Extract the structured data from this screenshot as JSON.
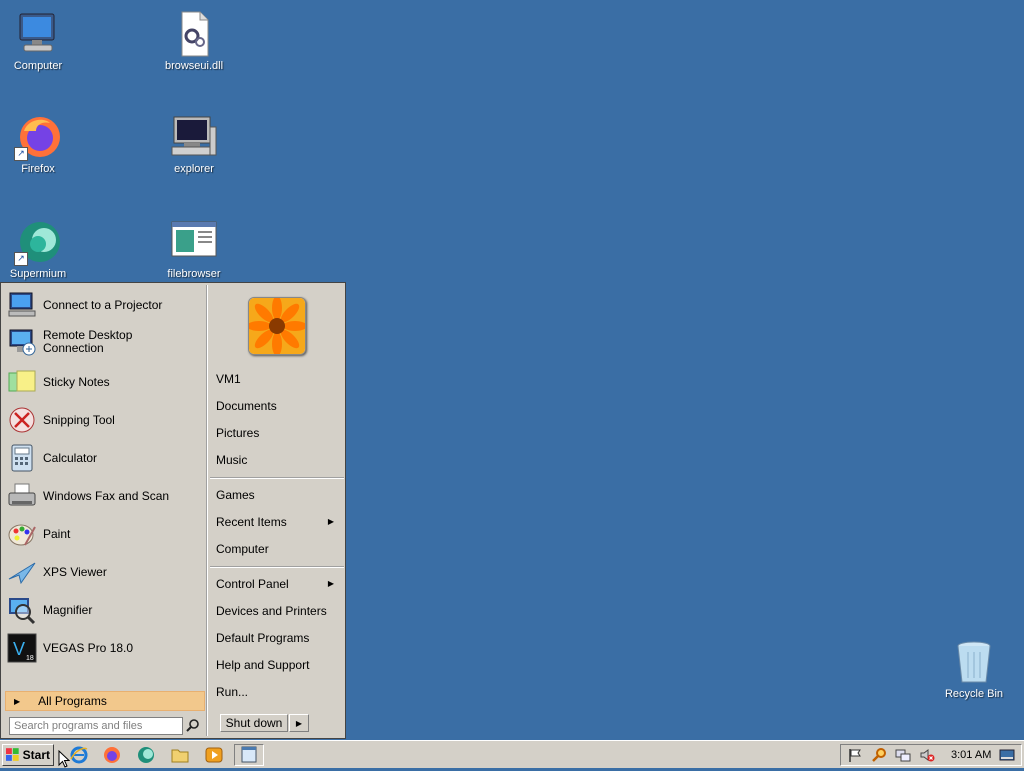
{
  "desktop": {
    "icons": [
      {
        "label": "Computer",
        "icon": "computer-icon"
      },
      {
        "label": "browseui.dll",
        "icon": "dll-file-icon"
      },
      {
        "label": "Firefox",
        "icon": "firefox-icon"
      },
      {
        "label": "explorer",
        "icon": "explorer-icon"
      },
      {
        "label": "Supermium",
        "icon": "supermium-icon"
      },
      {
        "label": "filebrowser",
        "icon": "filebrowser-icon"
      },
      {
        "label": "Recycle Bin",
        "icon": "recycle-bin-icon"
      }
    ]
  },
  "start_menu": {
    "programs": [
      {
        "label": "Connect to a Projector",
        "icon": "projector-icon"
      },
      {
        "label": "Remote Desktop\nConnection",
        "icon": "remote-desktop-icon"
      },
      {
        "label": "Sticky Notes",
        "icon": "sticky-notes-icon"
      },
      {
        "label": "Snipping Tool",
        "icon": "snipping-tool-icon"
      },
      {
        "label": "Calculator",
        "icon": "calculator-icon"
      },
      {
        "label": "Windows Fax and Scan",
        "icon": "fax-scan-icon"
      },
      {
        "label": "Paint",
        "icon": "paint-icon"
      },
      {
        "label": "XPS Viewer",
        "icon": "xps-viewer-icon"
      },
      {
        "label": "Magnifier",
        "icon": "magnifier-icon"
      },
      {
        "label": "VEGAS Pro 18.0",
        "icon": "vegas-pro-icon"
      }
    ],
    "all_programs": "All Programs",
    "search_placeholder": "Search programs and files",
    "places": [
      {
        "label": "VM1",
        "submenu": false
      },
      {
        "label": "Documents",
        "submenu": false
      },
      {
        "label": "Pictures",
        "submenu": false
      },
      {
        "label": "Music",
        "submenu": false
      },
      {
        "label": "Games",
        "submenu": false
      },
      {
        "label": "Recent Items",
        "submenu": true
      },
      {
        "label": "Computer",
        "submenu": false
      },
      {
        "label": "Control Panel",
        "submenu": true
      },
      {
        "label": "Devices and Printers",
        "submenu": false
      },
      {
        "label": "Default Programs",
        "submenu": false
      },
      {
        "label": "Help and Support",
        "submenu": false
      },
      {
        "label": "Run...",
        "submenu": false
      }
    ],
    "shutdown_label": "Shut down"
  },
  "taskbar": {
    "start_label": "Start",
    "quick_launch": [
      "ie-icon",
      "firefox-icon",
      "supermium-icon",
      "folder-icon",
      "media-player-icon",
      "window-icon"
    ],
    "tray_icons": [
      "flag-icon",
      "search-icon",
      "network-icon",
      "volume-muted-icon"
    ],
    "clock": "3:01 AM"
  },
  "colors": {
    "desktop": "#3a6ea5",
    "menu": "#d4d0c8",
    "all_programs_highlight": "#f2c88c"
  }
}
